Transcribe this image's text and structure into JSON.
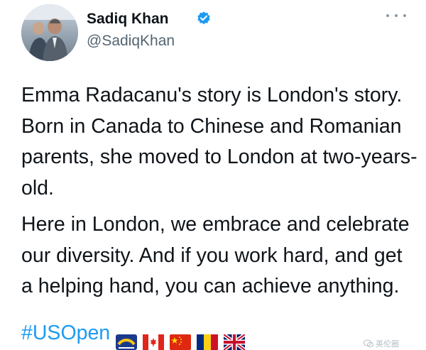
{
  "tweet": {
    "author": {
      "display_name": "Sadiq Khan",
      "handle": "@SadiqKhan",
      "verified": true
    },
    "paragraphs": [
      "Emma Radacanu's story is London's story. Born in Canada to Chinese and Romanian parents, she moved to London at two-years-old.",
      "Here in London, we embrace and celebrate our diversity. And if you work hard, and get a helping hand, you can achieve anything."
    ],
    "hashtag": "#USOpen",
    "emojis": [
      "usopen-trophy-emoji",
      "canada-flag-emoji",
      "china-flag-emoji",
      "romania-flag-emoji",
      "uk-flag-emoji"
    ]
  },
  "watermark": {
    "text": "英伦圈"
  },
  "colors": {
    "accent": "#1d9bf0",
    "text": "#0f1419",
    "secondary": "#536471"
  }
}
